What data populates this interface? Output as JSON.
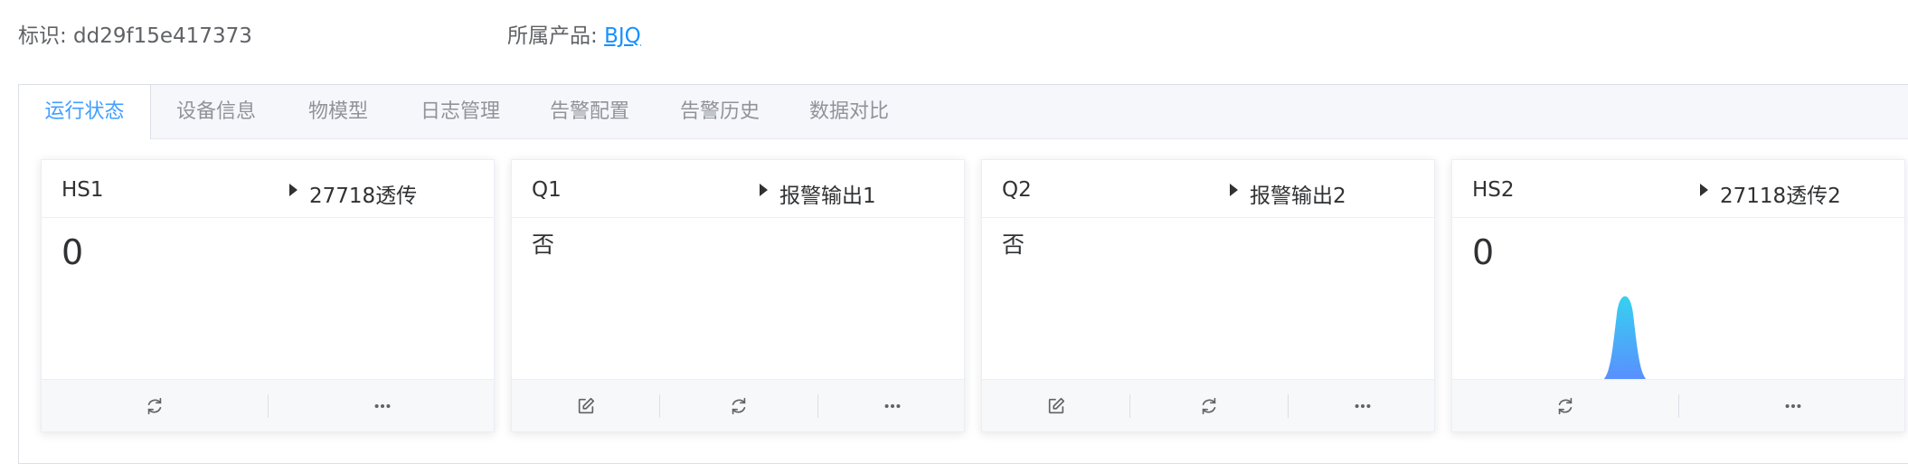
{
  "header": {
    "id_label": "标识: dd29f15e417373",
    "product_label": "所属产品: ",
    "product_link": "BJQ"
  },
  "tabs": [
    {
      "label": "运行状态",
      "active": true
    },
    {
      "label": "设备信息",
      "active": false
    },
    {
      "label": "物模型",
      "active": false
    },
    {
      "label": "日志管理",
      "active": false
    },
    {
      "label": "告警配置",
      "active": false
    },
    {
      "label": "告警历史",
      "active": false
    },
    {
      "label": "数据对比",
      "active": false
    }
  ],
  "colors": {
    "accent": "#409eff",
    "link": "#1890ff",
    "spike_top": "#36d1f0",
    "spike_bottom": "#5b8cff"
  },
  "cards": [
    {
      "id": "HS1",
      "name": "27718透传",
      "value": "0",
      "actions": [
        "refresh-icon",
        "more-icon"
      ]
    },
    {
      "id": "Q1",
      "name": "报警输出1",
      "value": "否",
      "actions": [
        "edit-icon",
        "refresh-icon",
        "more-icon"
      ]
    },
    {
      "id": "Q2",
      "name": "报警输出2",
      "value": "否",
      "actions": [
        "edit-icon",
        "refresh-icon",
        "more-icon"
      ]
    },
    {
      "id": "HS2",
      "name": "27118透传2",
      "value": "0",
      "actions": [
        "refresh-icon",
        "more-icon"
      ]
    }
  ]
}
